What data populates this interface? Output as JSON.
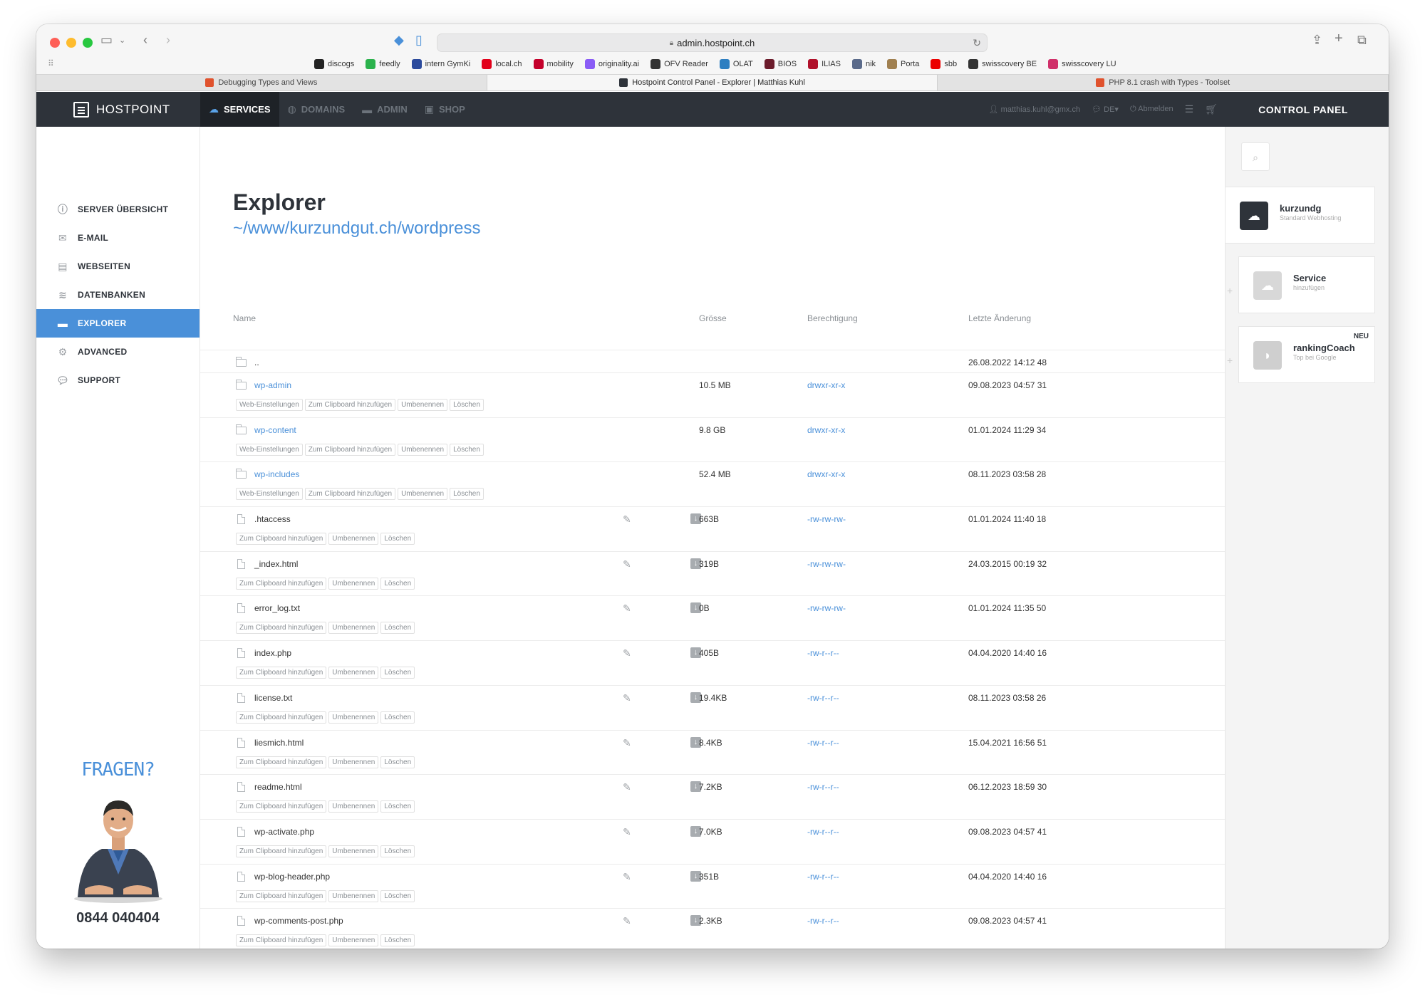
{
  "browser": {
    "url": "admin.hostpoint.ch",
    "bookmarks": [
      {
        "label": "discogs",
        "color": "#222"
      },
      {
        "label": "feedly",
        "color": "#2bb24c"
      },
      {
        "label": "intern GymKi",
        "color": "#2b4a9c"
      },
      {
        "label": "local.ch",
        "color": "#e2001a"
      },
      {
        "label": "mobility",
        "color": "#c4002b"
      },
      {
        "label": "originality.ai",
        "color": "#8a5cf6"
      },
      {
        "label": "OFV Reader",
        "color": "#333"
      },
      {
        "label": "OLAT",
        "color": "#2e7fc1"
      },
      {
        "label": "BIOS",
        "color": "#6b1b2b"
      },
      {
        "label": "ILIAS",
        "color": "#b0102a"
      },
      {
        "label": "nik",
        "color": "#5a6a8a"
      },
      {
        "label": "Porta",
        "color": "#a08050"
      },
      {
        "label": "sbb",
        "color": "#eb0000"
      },
      {
        "label": "swisscovery BE",
        "color": "#333"
      },
      {
        "label": "swisscovery LU",
        "color": "#d0306a"
      }
    ],
    "tabs": [
      {
        "label": "Debugging Types and Views",
        "color": "#e0522d"
      },
      {
        "label": "Hostpoint Control Panel - Explorer | Matthias Kuhl",
        "color": "#2e333a"
      },
      {
        "label": "PHP 8.1 crash with Types - Toolset",
        "color": "#e0522d"
      }
    ]
  },
  "topnav": {
    "logo": "HOSTPOINT",
    "items": [
      {
        "label": "SERVICES",
        "icon": "cloud-icon"
      },
      {
        "label": "DOMAINS",
        "icon": "globe-icon"
      },
      {
        "label": "ADMIN",
        "icon": "card-icon"
      },
      {
        "label": "SHOP",
        "icon": "bag-icon"
      }
    ],
    "user": "matthias.kuhl@gmx.ch",
    "language": "DE",
    "logout": "Abmelden",
    "control_panel": "CONTROL PANEL"
  },
  "sidebar": {
    "items": [
      {
        "label": "SERVER ÜBERSICHT",
        "icon": "info-icon"
      },
      {
        "label": "E-MAIL",
        "icon": "mail-icon"
      },
      {
        "label": "WEBSEITEN",
        "icon": "browser-icon"
      },
      {
        "label": "DATENBANKEN",
        "icon": "database-icon"
      },
      {
        "label": "EXPLORER",
        "icon": "folder-icon"
      },
      {
        "label": "ADVANCED",
        "icon": "gear-icon"
      },
      {
        "label": "SUPPORT",
        "icon": "chat-icon"
      }
    ],
    "questions": "FRAGEN?",
    "phone": "0844 040404"
  },
  "main": {
    "title": "Explorer",
    "path": "~/www/kurzundgut.ch/wordpress",
    "columns": {
      "name": "Name",
      "size": "Grösse",
      "perm": "Berechtigung",
      "date": "Letzte Änderung"
    },
    "folder_actions": [
      "Web-Einstellungen",
      "Zum Clipboard hinzufügen",
      "Umbenennen",
      "Löschen"
    ],
    "file_actions": [
      "Zum Clipboard hinzufügen",
      "Umbenennen",
      "Löschen"
    ],
    "parent": {
      "name": "..",
      "date": "26.08.2022 14:12 48"
    },
    "rows": [
      {
        "type": "folder",
        "name": "wp-admin",
        "size": "10.5 MB",
        "perm": "drwxr-xr-x",
        "date": "09.08.2023 04:57 31"
      },
      {
        "type": "folder",
        "name": "wp-content",
        "size": "9.8 GB",
        "perm": "drwxr-xr-x",
        "date": "01.01.2024 11:29 34"
      },
      {
        "type": "folder",
        "name": "wp-includes",
        "size": "52.4 MB",
        "perm": "drwxr-xr-x",
        "date": "08.11.2023 03:58 28"
      },
      {
        "type": "file",
        "name": ".htaccess",
        "size": "663B",
        "perm": "-rw-rw-rw-",
        "date": "01.01.2024 11:40 18"
      },
      {
        "type": "file",
        "name": "_index.html",
        "size": "319B",
        "perm": "-rw-rw-rw-",
        "date": "24.03.2015 00:19 32"
      },
      {
        "type": "file",
        "name": "error_log.txt",
        "size": "0B",
        "perm": "-rw-rw-rw-",
        "date": "01.01.2024 11:35 50"
      },
      {
        "type": "file",
        "name": "index.php",
        "size": "405B",
        "perm": "-rw-r--r--",
        "date": "04.04.2020 14:40 16"
      },
      {
        "type": "file",
        "name": "license.txt",
        "size": "19.4KB",
        "perm": "-rw-r--r--",
        "date": "08.11.2023 03:58 26"
      },
      {
        "type": "file",
        "name": "liesmich.html",
        "size": "8.4KB",
        "perm": "-rw-r--r--",
        "date": "15.04.2021 16:56 51"
      },
      {
        "type": "file",
        "name": "readme.html",
        "size": "7.2KB",
        "perm": "-rw-r--r--",
        "date": "06.12.2023 18:59 30"
      },
      {
        "type": "file",
        "name": "wp-activate.php",
        "size": "7.0KB",
        "perm": "-rw-r--r--",
        "date": "09.08.2023 04:57 41"
      },
      {
        "type": "file",
        "name": "wp-blog-header.php",
        "size": "351B",
        "perm": "-rw-r--r--",
        "date": "04.04.2020 14:40 16"
      },
      {
        "type": "file",
        "name": "wp-comments-post.php",
        "size": "2.3KB",
        "perm": "-rw-r--r--",
        "date": "09.08.2023 04:57 41"
      }
    ]
  },
  "rightpanel": {
    "cards": [
      {
        "title": "kurzundg",
        "sub": "Standard Webhosting",
        "badge": "",
        "icon": "cloud-icon",
        "color": "#2e333a"
      },
      {
        "title": "Service",
        "sub": "hinzufügen",
        "badge": "",
        "icon": "cloud-icon",
        "color": "#d8d8d8"
      },
      {
        "title": "rankingCoach",
        "sub": "Top bei Google",
        "badge": "NEU",
        "icon": "rankingcoach-icon",
        "color": "#cfcfcf"
      }
    ]
  }
}
